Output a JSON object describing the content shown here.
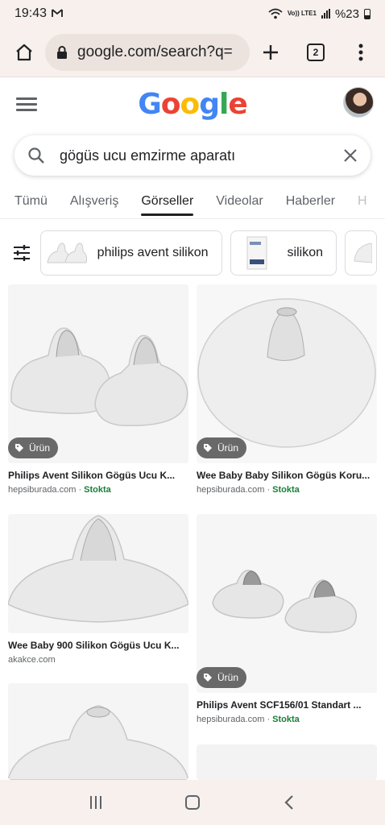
{
  "status": {
    "time": "19:43",
    "mail_icon": "gmail-icon",
    "lte": "Vo)) LTE1",
    "battery": "%23"
  },
  "browser": {
    "url": "google.com/search?q=",
    "tab_count": "2"
  },
  "google": {
    "logo": [
      "G",
      "o",
      "o",
      "g",
      "l",
      "e"
    ],
    "logo_colors": [
      "#4285F4",
      "#EA4335",
      "#FBBC05",
      "#4285F4",
      "#34A853",
      "#EA4335"
    ],
    "query": "gögüs ucu emzirme aparatı"
  },
  "tabs": [
    {
      "label": "Tümü"
    },
    {
      "label": "Alışveriş"
    },
    {
      "label": "Görseller"
    },
    {
      "label": "Videolar"
    },
    {
      "label": "Haberler"
    },
    {
      "label": "H"
    }
  ],
  "chips": [
    {
      "label": "philips avent silikon"
    },
    {
      "label": "silikon"
    }
  ],
  "results": [
    {
      "badge": "Ürün",
      "title": "Philips Avent Silikon Gögüs Ucu K...",
      "source": "hepsiburada.com",
      "stock": "Stokta"
    },
    {
      "badge": "Ürün",
      "title": "Wee Baby Baby Silikon Gögüs Koru...",
      "source": "hepsiburada.com",
      "stock": "Stokta"
    },
    {
      "badge": "",
      "title": "Wee Baby 900 Silikon Gögüs Ucu K...",
      "source": "akakce.com",
      "stock": ""
    },
    {
      "badge": "Ürün",
      "title": "Philips Avent SCF156/01 Standart ...",
      "source": "hepsiburada.com",
      "stock": "Stokta"
    }
  ],
  "colors": {
    "stock": "#188038",
    "browser_bar": "#f7f0ec"
  }
}
